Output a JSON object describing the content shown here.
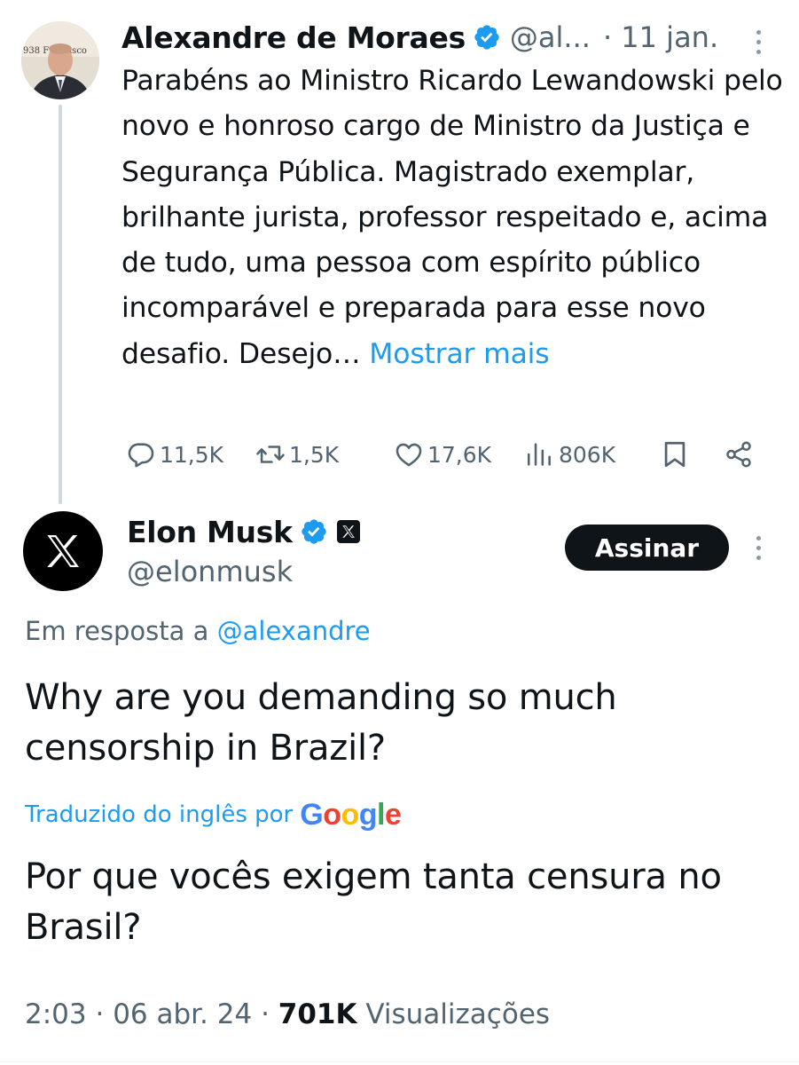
{
  "first_tweet": {
    "author_name": "Alexandre de Moraes",
    "handle": "@al...",
    "time": "· 11 jan.",
    "text": "Parabéns ao Ministro Ricardo Lewandowski pelo novo e honroso cargo de Ministro da Justiça e Segurança Pública. Magistrado exemplar, brilhante jurista, professor respeitado e, acima de tudo, uma pessoa com espírito público incomparável e preparada para esse novo desafio. Desejo…",
    "show_more": "Mostrar mais",
    "avatar_text": "938 Francisco",
    "stats": {
      "replies": "11,5K",
      "reposts": "1,5K",
      "likes": "17,6K",
      "views": "806K"
    }
  },
  "reply_tweet": {
    "author_name": "Elon Musk",
    "handle": "@elonmusk",
    "subscribe_label": "Assinar",
    "in_reply_to_prefix": "Em resposta a",
    "in_reply_to_handle": "@alexandre",
    "text": "Why are you demanding so much censorship in Brazil?",
    "translated_by": "Traduzido do inglês por",
    "translator": "Google",
    "translation": "Por que vocês exigem tanta censura no Brasil?",
    "time": "2:03",
    "date": "06 abr. 24",
    "views_count": "701K",
    "views_label": "Visualizações"
  },
  "colors": {
    "text": "#0f1419",
    "secondary": "#536471",
    "link": "#1d9bf0",
    "verified": "#1d9bf0",
    "button_bg": "#0f1419"
  },
  "icons": [
    "verified-badge-icon",
    "more-options-icon",
    "reply-icon",
    "repost-icon",
    "like-icon",
    "views-icon",
    "bookmark-icon",
    "share-icon",
    "x-logo-icon",
    "google-logo"
  ]
}
